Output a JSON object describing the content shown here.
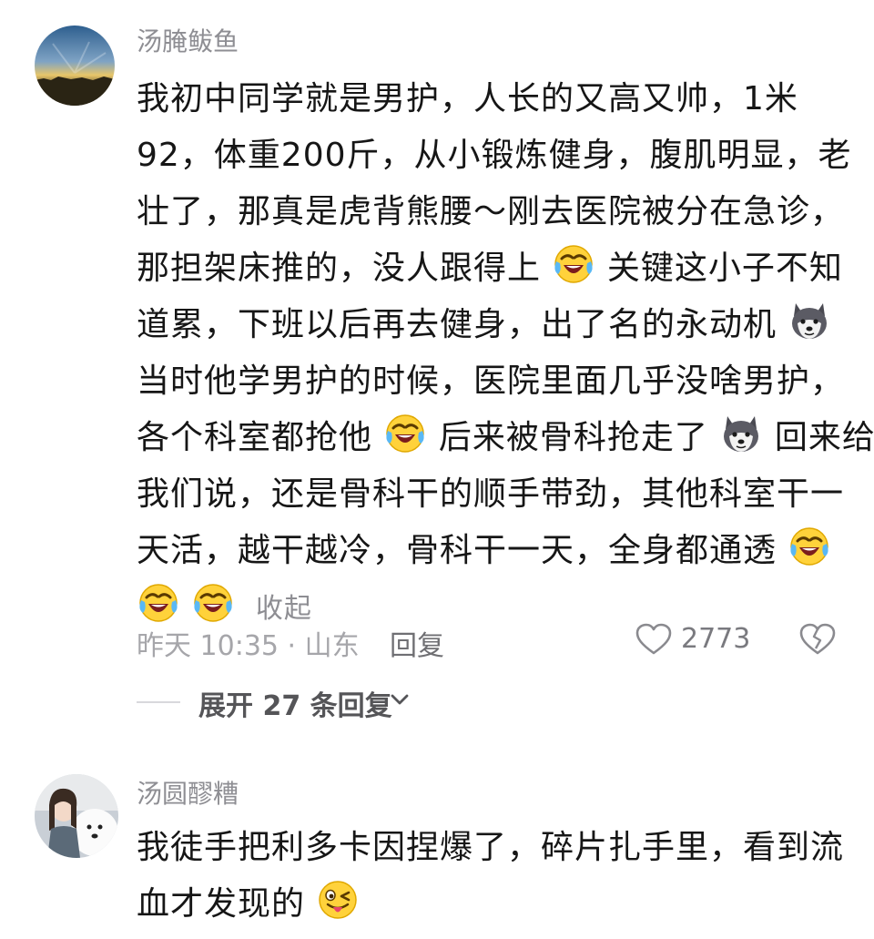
{
  "comment1": {
    "username": "汤腌鲅鱼",
    "lines": [
      [
        "我初中同学就是男护，人长的又高又帅，1米"
      ],
      [
        "92，体重200斤，从小锻炼健身，腹肌明显，老"
      ],
      [
        "壮了，那真是虎背熊腰～刚去医院被分在急诊，"
      ],
      [
        "那担架床推的，没人跟得上",
        "关键这小子不知"
      ],
      [
        "道累，下班以后再去健身，出了名的永动机"
      ],
      [
        "当时他学男护的时候，医院里面几乎没啥男护，"
      ],
      [
        "各个科室都抢他",
        "后来被骨科抢走了",
        "回来给"
      ],
      [
        "我们说，还是骨科干的顺手带劲，其他科室干一"
      ],
      [
        "天活，越干越冷，骨科干一天，全身都通透"
      ],
      [
        "收起"
      ]
    ],
    "emojis": [
      "laugh-cry-emoji",
      "husky-dog-emoji",
      "sly-face-emoji",
      "wink-tongue-emoji"
    ],
    "collapse_label": "收起",
    "time_location": "昨天 10:35 · 山东",
    "reply_label": "回复",
    "like_count": "2773",
    "expand_replies_label": "展开 27 条回复"
  },
  "comment2": {
    "username": "汤圆醪糟",
    "lines": [
      [
        "我徒手把利多卡因捏爆了，碎片扎手里，看到流"
      ],
      [
        "血才发现的"
      ]
    ]
  },
  "colors": {
    "username": "#8e8e93",
    "body": "#161616",
    "meta": "#a6a6aa"
  }
}
